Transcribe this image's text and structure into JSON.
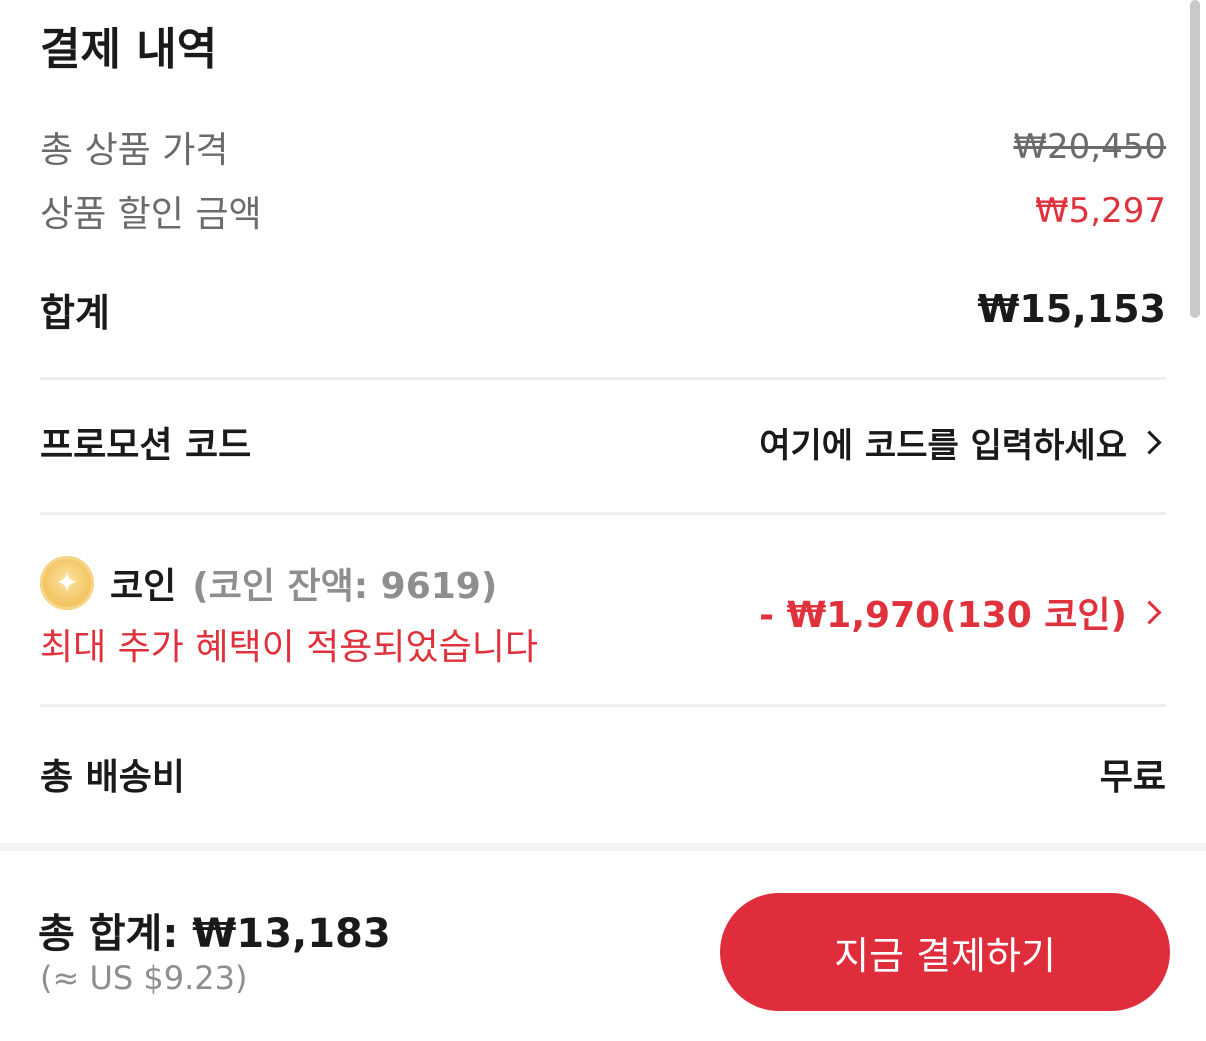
{
  "summary": {
    "title": "결제 내역",
    "subtotal_label": "총 상품 가격",
    "subtotal_value": "₩20,450",
    "discount_label": "상품 할인 금액",
    "discount_value": "₩5,297",
    "sum_label": "합계",
    "sum_value": "₩15,153"
  },
  "promo": {
    "label": "프로모션 코드",
    "placeholder": "여기에 코드를 입력하세요"
  },
  "coins": {
    "label": "코인",
    "balance": "(코인 잔액: 9619)",
    "note": "최대 추가 혜택이 적용되었습니다",
    "value": "- ₩1,970(130 코인)"
  },
  "shipping": {
    "label": "총 배송비",
    "value": "무료"
  },
  "footer": {
    "total": "총 합계: ₩13,183",
    "usd": "(≈ US $9.23)",
    "pay_button": "지금 결제하기"
  },
  "colors": {
    "accent_red": "#e02d3c",
    "text_primary": "#1a1a1a",
    "text_secondary": "#6b6b6b"
  }
}
